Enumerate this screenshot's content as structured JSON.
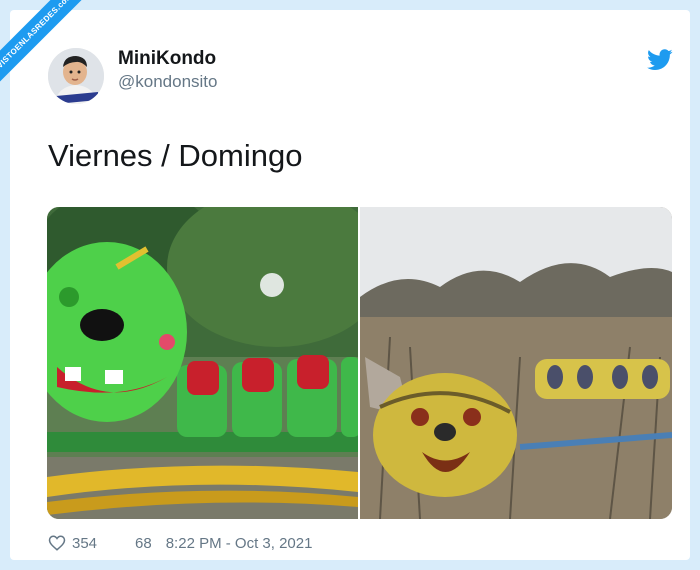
{
  "watermark": {
    "text": "VISTOENLASREDES.com"
  },
  "tweet": {
    "display_name": "MiniKondo",
    "handle": "@kondonsito",
    "text": "Viernes / Domingo",
    "likes": "354",
    "retweets": "68",
    "timestamp": "8:22 PM - Oct 3, 2021"
  },
  "colors": {
    "brand": "#1d9bf0",
    "background": "#d8ecfa"
  },
  "icons": {
    "platform": "twitter-bird-icon",
    "like": "heart-icon"
  }
}
